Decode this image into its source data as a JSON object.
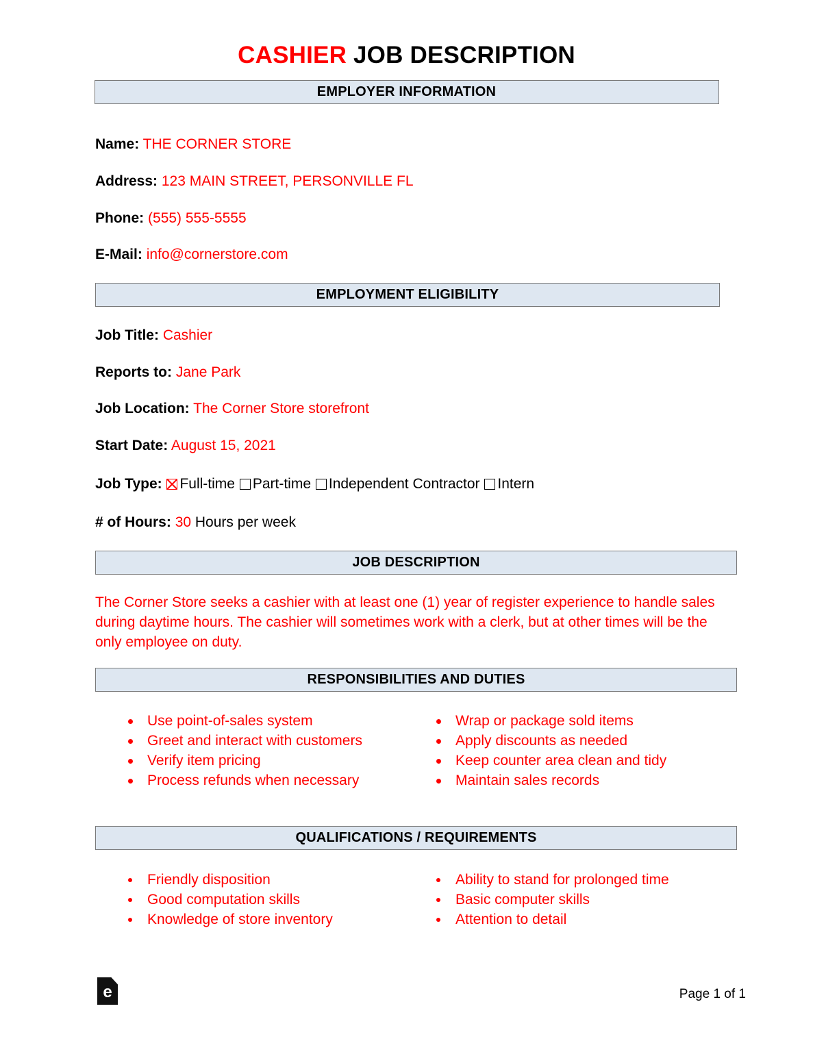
{
  "document": {
    "title_accent": "CASHIER",
    "title_plain": "JOB DESCRIPTION",
    "accent_color": "#FF0000",
    "header_bar_color": "#dee7f1"
  },
  "sections": {
    "employer_information": {
      "heading": "EMPLOYER INFORMATION",
      "fields": [
        {
          "label": "Name",
          "value": "THE CORNER STORE"
        },
        {
          "label": "Address",
          "value": "123 MAIN STREET, PERSONVILLE FL"
        },
        {
          "label": "Phone",
          "value": "(555) 555-5555"
        },
        {
          "label": "E-Mail",
          "value": "info@cornerstore.com"
        }
      ]
    },
    "employment_eligibility": {
      "heading": "EMPLOYMENT ELIGIBILITY",
      "fields": [
        {
          "label": "Job Title",
          "value": "Cashier"
        },
        {
          "label": "Reports to",
          "value": "Jane Park"
        },
        {
          "label": "Job Location",
          "value": "The Corner Store storefront"
        },
        {
          "label": "Start Date",
          "value": "August 15, 2021"
        }
      ],
      "job_type": {
        "label": "Job Type",
        "options": [
          {
            "label": "Full-time",
            "checked": true
          },
          {
            "label": "Part-time",
            "checked": false
          },
          {
            "label": "Independent Contractor",
            "checked": false
          },
          {
            "label": "Intern",
            "checked": false
          }
        ]
      },
      "hours": {
        "label": "# of Hours",
        "value": "30",
        "suffix": "Hours per week"
      }
    },
    "job_description": {
      "heading": "JOB DESCRIPTION",
      "paragraph": "The Corner Store seeks a cashier with at least one (1) year of register experience to handle sales during daytime hours. The cashier will sometimes work with a clerk, but at other times will be the only employee on duty."
    },
    "responsibilities": {
      "heading": "RESPONSIBILITIES AND DUTIES",
      "column_left": [
        "Use point-of-sales system",
        "Greet and interact with customers",
        "Verify item pricing",
        "Process refunds when necessary"
      ],
      "column_right": [
        "Wrap or package sold items",
        "Apply discounts as needed",
        "Keep counter area clean and tidy",
        "Maintain sales records"
      ]
    },
    "qualifications": {
      "heading": "QUALIFICATIONS / REQUIREMENTS",
      "column_left": [
        "Friendly disposition",
        "Good computation skills",
        "Knowledge of store inventory"
      ],
      "column_right": [
        "Ability to stand for prolonged time",
        "Basic computer skills",
        "Attention to detail"
      ]
    }
  },
  "footer": {
    "logo_letter": "e",
    "page_number": "Page 1 of 1"
  }
}
